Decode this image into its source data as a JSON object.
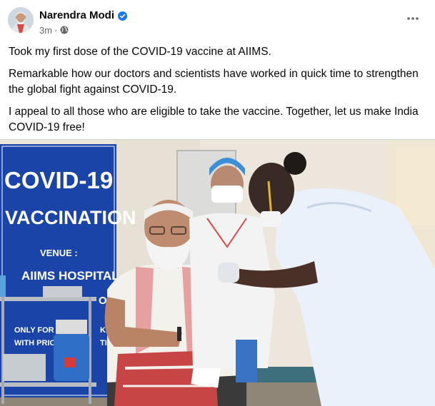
{
  "author": {
    "name": "Narendra Modi",
    "verified": true
  },
  "post_meta": {
    "time": "3m",
    "separator": "·",
    "audience_icon": "globe-icon"
  },
  "menu_icon": "more-horizontal-icon",
  "post_text": {
    "paragraphs": [
      "Took my first dose of the COVID-19 vaccine at AIIMS.",
      "Remarkable how our doctors and scientists have worked in quick time to strengthen the global fight against COVID-19.",
      "I appeal to all those who are eligible to take the vaccine. Together, let us make India COVID-19 free!"
    ]
  },
  "photo": {
    "banner": {
      "line1": "COVID-19",
      "line2": "VACCINATION",
      "line3": "VENUE :",
      "line4": "AIIMS HOSPITAL",
      "line5": "OR",
      "line6": "ONLY FOR HE",
      "line7": "WITH PRIOR",
      "line8": "KE",
      "line9": "TIO"
    }
  },
  "colors": {
    "verified_badge": "#1877f2",
    "secondary_text": "#65676b",
    "banner_blue": "#1a44a8"
  }
}
